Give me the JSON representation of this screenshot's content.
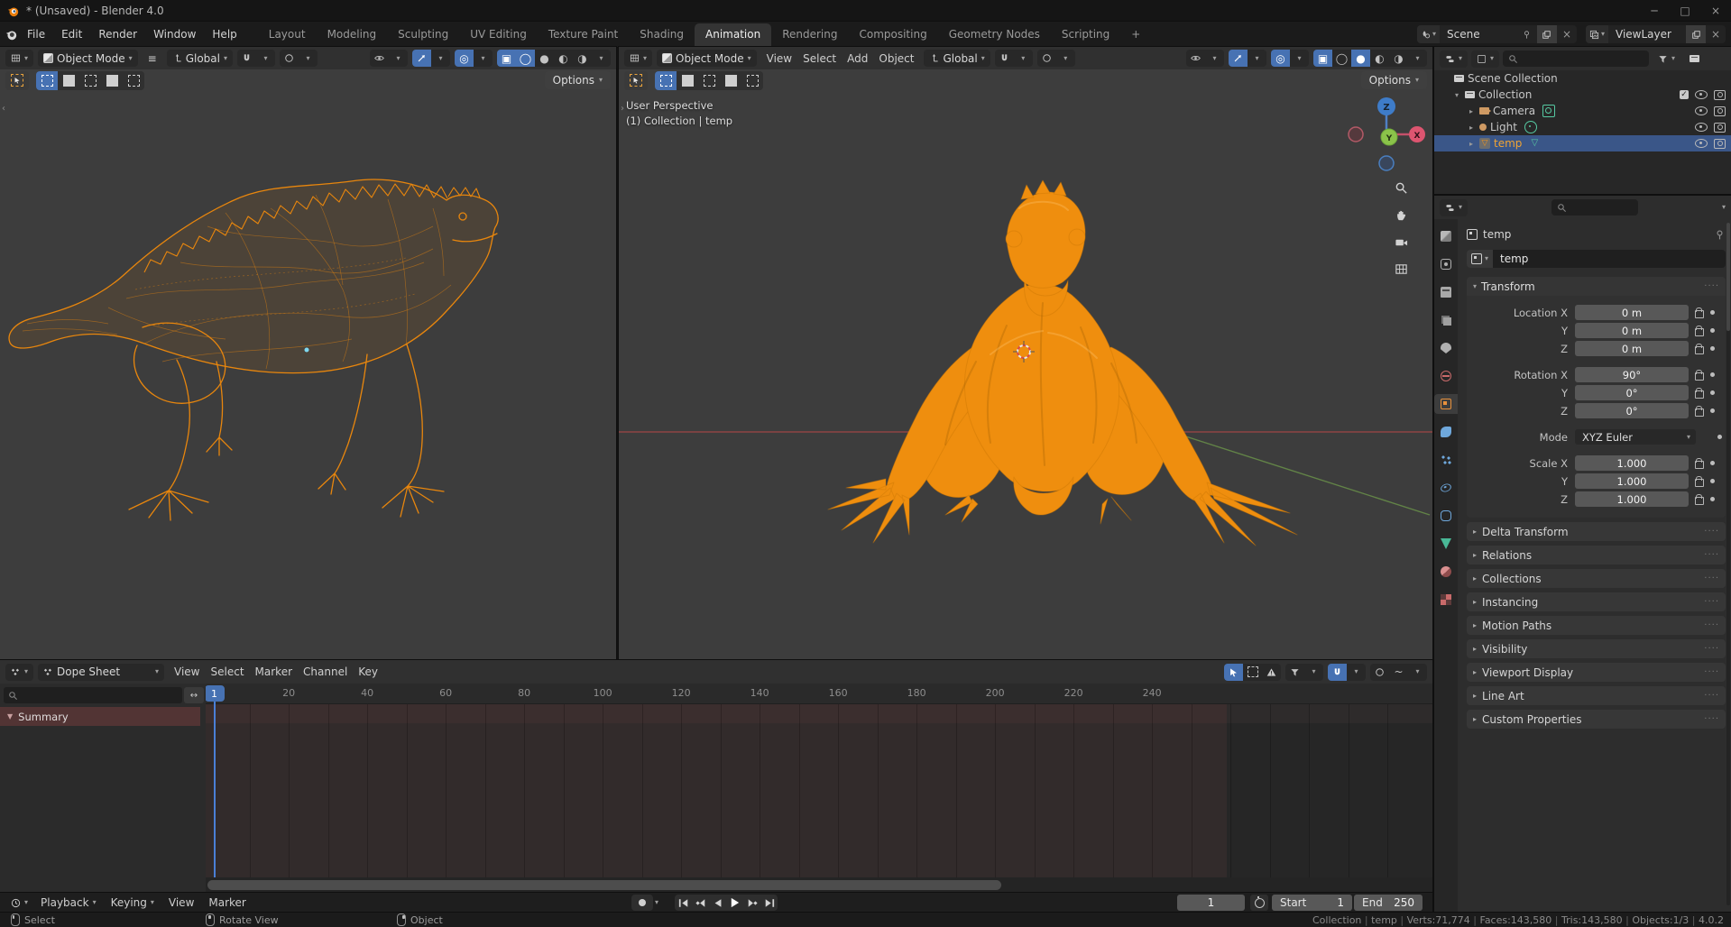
{
  "window": {
    "title": "* (Unsaved) - Blender 4.0",
    "minimize": "─",
    "maximize": "□",
    "close": "×"
  },
  "topbar": {
    "menus": [
      "File",
      "Edit",
      "Render",
      "Window",
      "Help"
    ],
    "tabs": [
      {
        "label": "Layout"
      },
      {
        "label": "Modeling"
      },
      {
        "label": "Sculpting"
      },
      {
        "label": "UV Editing"
      },
      {
        "label": "Texture Paint"
      },
      {
        "label": "Shading"
      },
      {
        "label": "Animation",
        "cls": "active"
      },
      {
        "label": "Rendering"
      },
      {
        "label": "Compositing"
      },
      {
        "label": "Geometry Nodes"
      },
      {
        "label": "Scripting"
      },
      {
        "label": "+"
      }
    ],
    "scene_label": "Scene",
    "view_layer_label": "ViewLayer"
  },
  "viewport_left": {
    "mode": "Object Mode",
    "orientation": "Global",
    "options_label": "Options"
  },
  "viewport_right": {
    "mode": "Object Mode",
    "menus": [
      "View",
      "Select",
      "Add",
      "Object"
    ],
    "orientation": "Global",
    "options_label": "Options",
    "overlay_line1": "User Perspective",
    "overlay_line2": "(1) Collection | temp",
    "axis_z": "Z",
    "axis_y": "Y",
    "axis_x": "X"
  },
  "outliner": {
    "rows": [
      {
        "pad": 8,
        "exp": "",
        "icon": "collection-icon",
        "label": "Scene Collection",
        "cls": "r-none"
      },
      {
        "pad": 20,
        "exp": "▾",
        "icon": "collection-icon",
        "label": "Collection",
        "cls": "r-full"
      },
      {
        "pad": 36,
        "exp": "▸",
        "icon": "camera-object-icon",
        "label": "Camera",
        "dicon": "camera-data-icon",
        "cls": "r-ec"
      },
      {
        "pad": 36,
        "exp": "▸",
        "icon": "light-object-icon",
        "label": "Light",
        "dicon": "light-data-icon",
        "cls": "r-ec"
      },
      {
        "pad": 36,
        "exp": "▸",
        "icon": "mesh-object-icon",
        "label": "temp",
        "dicon": "mesh-data-icon",
        "cls": "r-ec selected"
      }
    ]
  },
  "properties": {
    "breadcrumb": "temp",
    "name_value": "temp",
    "tabs": [
      {
        "icon": "tool-icon"
      },
      {
        "icon": "render-icon"
      },
      {
        "icon": "output-icon"
      },
      {
        "icon": "view-layer-icon"
      },
      {
        "icon": "scene-icon"
      },
      {
        "icon": "world-icon"
      },
      {
        "icon": "object-icon",
        "cls": "active"
      },
      {
        "icon": "modifiers-icon"
      },
      {
        "icon": "particles-icon"
      },
      {
        "icon": "physics-icon"
      },
      {
        "icon": "constraints-icon"
      },
      {
        "icon": "data-icon"
      },
      {
        "icon": "material-icon"
      },
      {
        "icon": "texture-icon"
      }
    ],
    "transform": {
      "title": "Transform",
      "rows": [
        {
          "label": "Location X",
          "value": "0 m",
          "cls": "num"
        },
        {
          "label": "Y",
          "value": "0 m",
          "cls": "num"
        },
        {
          "label": "Z",
          "value": "0 m",
          "cls": "num"
        },
        {
          "label": "Rotation X",
          "value": "90°",
          "cls": "num gap"
        },
        {
          "label": "Y",
          "value": "0°",
          "cls": "num"
        },
        {
          "label": "Z",
          "value": "0°",
          "cls": "num"
        },
        {
          "label": "Mode",
          "value": "XYZ Euler",
          "cls": "dropdown gap"
        },
        {
          "label": "Scale X",
          "value": "1.000",
          "cls": "num gap"
        },
        {
          "label": "Y",
          "value": "1.000",
          "cls": "num"
        },
        {
          "label": "Z",
          "value": "1.000",
          "cls": "num"
        }
      ]
    },
    "sections": [
      {
        "label": "Delta Transform"
      },
      {
        "label": "Relations"
      },
      {
        "label": "Collections"
      },
      {
        "label": "Instancing"
      },
      {
        "label": "Motion Paths"
      },
      {
        "label": "Visibility"
      },
      {
        "label": "Viewport Display"
      },
      {
        "label": "Line Art"
      },
      {
        "label": "Custom Properties"
      }
    ]
  },
  "dope_sheet": {
    "editor_label": "Dope Sheet",
    "menus": [
      "View",
      "Select",
      "Marker",
      "Channel",
      "Key"
    ],
    "summary_label": "Summary",
    "current_frame": "1",
    "ticks": [
      20,
      40,
      60,
      80,
      100,
      120,
      140,
      160,
      180,
      200,
      220,
      240
    ]
  },
  "playback": {
    "menus": [
      {
        "label": "Playback",
        "cls": "dd"
      },
      {
        "label": "Keying",
        "cls": "dd"
      },
      {
        "label": "View"
      },
      {
        "label": "Marker"
      }
    ],
    "frame": "1",
    "start_label": "Start",
    "start_value": "1",
    "end_label": "End",
    "end_value": "250"
  },
  "status_bar": {
    "hints": [
      {
        "btn": "left",
        "label": "Select"
      },
      {
        "btn": "middle",
        "label": "Rotate View"
      },
      {
        "btn": "right",
        "label": "Object"
      }
    ],
    "stats": [
      "Collection",
      "temp",
      "Verts:71,774",
      "Faces:143,580",
      "Tris:143,580",
      "Objects:1/3",
      "4.0.2"
    ]
  },
  "colors": {
    "accent_blue": "#4772b3",
    "object_orange": "#ef8e0e",
    "wire_orange": "#e8860d",
    "playhead_blue": "#4a7fd6",
    "selected_row_blue": "#3a5688"
  }
}
